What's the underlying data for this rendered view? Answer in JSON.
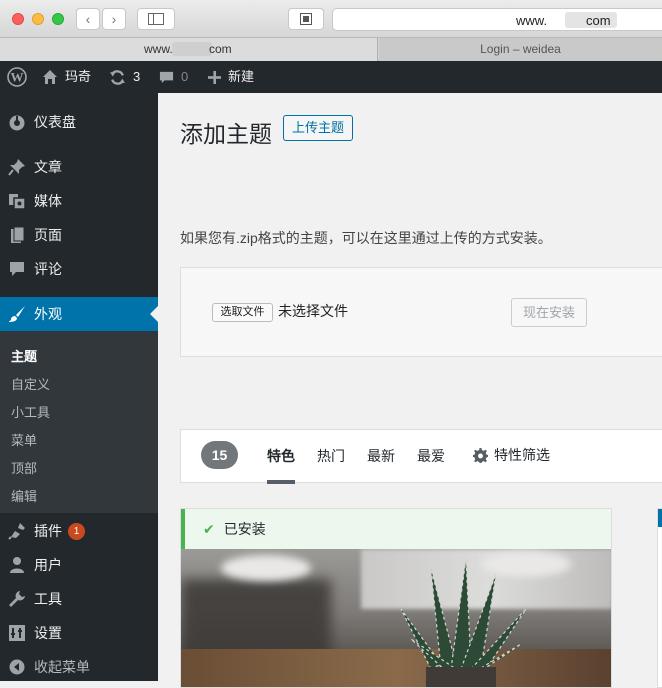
{
  "browser": {
    "url_left": "www.",
    "url_right": "com",
    "tabs": [
      {
        "label_left": "www.",
        "label_right": "com"
      },
      {
        "label": "Login – weidea"
      }
    ]
  },
  "adminbar": {
    "site_name": "玛奇",
    "updates_count": "3",
    "comments_count": "0",
    "new_label": "新建"
  },
  "sidebar": {
    "items": [
      {
        "label": "仪表盘",
        "icon": "dashboard-icon"
      },
      {
        "label": "文章",
        "icon": "pin-icon"
      },
      {
        "label": "媒体",
        "icon": "media-icon"
      },
      {
        "label": "页面",
        "icon": "page-icon"
      },
      {
        "label": "评论",
        "icon": "comment-icon"
      },
      {
        "label": "外观",
        "icon": "brush-icon",
        "active": true
      },
      {
        "label": "插件",
        "icon": "plugin-icon",
        "badge": "1"
      },
      {
        "label": "用户",
        "icon": "user-icon"
      },
      {
        "label": "工具",
        "icon": "wrench-icon"
      },
      {
        "label": "设置",
        "icon": "settings-icon"
      },
      {
        "label": "收起菜单",
        "icon": "collapse-icon"
      }
    ],
    "submenu": [
      "主题",
      "自定义",
      "小工具",
      "菜单",
      "顶部",
      "编辑"
    ]
  },
  "main": {
    "title": "添加主题",
    "upload_button": "上传主题",
    "intro": "如果您有.zip格式的主题，可以在这里通过上传的方式安装。",
    "choose_file": "选取文件",
    "no_file": "未选择文件",
    "install_now": "现在安装",
    "filter": {
      "count": "15",
      "tabs": [
        "特色",
        "热门",
        "最新",
        "最爱"
      ],
      "feature_filter": "特性筛选"
    },
    "theme_card": {
      "installed_label": "已安装"
    }
  },
  "colors": {
    "admin_dark": "#23282d",
    "active_blue": "#0073aa",
    "installed_green": "#46b450",
    "badge_orange": "#ca4a1f"
  }
}
